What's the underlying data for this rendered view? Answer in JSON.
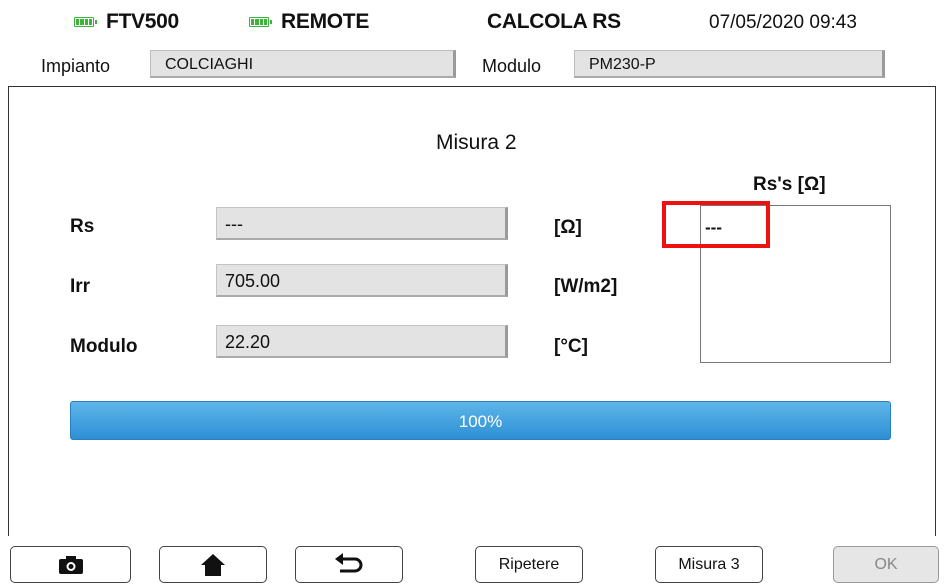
{
  "status": {
    "device_left": "FTV500",
    "device_right": "REMOTE",
    "screen_title": "CALCOLA RS",
    "datetime": "07/05/2020 09:43",
    "battery_color": "#3bb539"
  },
  "header": {
    "impianto_label": "Impianto",
    "impianto_value": "COLCIAGHI",
    "modulo_label": "Modulo",
    "modulo_value": "PM230-P"
  },
  "measure": {
    "title": "Misura 2",
    "rows": [
      {
        "label": "Rs",
        "value": "---",
        "unit": "[Ω]"
      },
      {
        "label": "Irr",
        "value": "705.00",
        "unit": "[W/m2]"
      },
      {
        "label": "Modulo",
        "value": "22.20",
        "unit": "[°C]"
      }
    ]
  },
  "rss_panel": {
    "heading": "Rs's [Ω]",
    "values": [
      "---"
    ],
    "highlight_color": "#ee1111"
  },
  "progress": {
    "value_percent": 100,
    "label": "100%",
    "color": "#2d8fd3"
  },
  "toolbar": {
    "camera_icon": "camera-icon",
    "home_icon": "home-icon",
    "back_icon": "back-arrow-icon",
    "repeat_label": "Ripetere",
    "next_label": "Misura 3",
    "ok_label": "OK"
  }
}
